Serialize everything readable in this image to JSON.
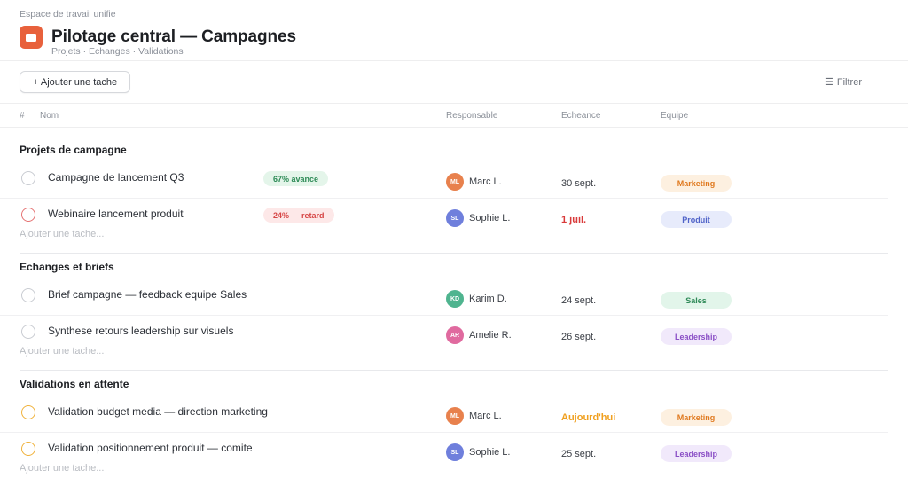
{
  "header": {
    "workspace": "Espace de travail unifie",
    "title": "Pilotage central — Campagnes",
    "subtitle": "Projets · Echanges · Validations",
    "icon": "board-icon",
    "icon_color": "#e8613c"
  },
  "toolbar": {
    "add_label": "+ Ajouter une tache",
    "filter_label": "Filtrer",
    "filter_icon": "☰"
  },
  "columns": {
    "num": "#",
    "name": "Nom",
    "owner": "Responsable",
    "due": "Echeance",
    "team": "Equipe"
  },
  "add_task_label": "Ajouter une tache...",
  "sections": [
    {
      "title": "Projets de campagne",
      "rows": [
        {
          "name": "Campagne de lancement Q3",
          "pill": "67% avance",
          "initials": "ML",
          "owner": "Marc L.",
          "due": "30 sept.",
          "team": "Marketing"
        },
        {
          "name": "Webinaire lancement produit",
          "pill": "24% — retard",
          "initials": "SL",
          "owner": "Sophie L.",
          "due": "1 juil.",
          "team": "Produit"
        }
      ]
    },
    {
      "title": "Echanges et briefs",
      "rows": [
        {
          "name": "Brief campagne — feedback equipe Sales",
          "initials": "KD",
          "owner": "Karim D.",
          "due": "24 sept.",
          "team": "Sales"
        },
        {
          "name": "Synthese retours leadership sur visuels",
          "initials": "AR",
          "owner": "Amelie R.",
          "due": "26 sept.",
          "team": "Leadership"
        }
      ]
    },
    {
      "title": "Validations en attente",
      "rows": [
        {
          "name": "Validation budget media — direction marketing",
          "initials": "ML",
          "owner": "Marc L.",
          "due": "Aujourd'hui",
          "team": "Marketing"
        },
        {
          "name": "Validation positionnement produit — comite",
          "initials": "SL",
          "owner": "Sophie L.",
          "due": "25 sept.",
          "team": "Leadership"
        }
      ]
    }
  ],
  "colors": {
    "status_ok_bg": "#e4f5ea",
    "status_ok_fg": "#2e8b57",
    "status_late_bg": "#fde8e8",
    "status_late_fg": "#d64545",
    "due_late": "#d93a3a",
    "due_today": "#f0a020",
    "check_late": "#e57373",
    "check_pending": "#f0b23c",
    "avatar_ML": "#e8814d",
    "avatar_SL": "#6f7fdc",
    "avatar_KD": "#4fb48f",
    "avatar_AR": "#e06a9f",
    "team_marketing_bg": "#fdf0e0",
    "team_marketing_fg": "#e07a20",
    "team_produit_bg": "#e7ebfb",
    "team_produit_fg": "#4f62c8",
    "team_sales_bg": "#e2f5ea",
    "team_sales_fg": "#2f8a58",
    "team_leadership_bg": "#f1e9fb",
    "team_leadership_fg": "#8a4fc6"
  }
}
